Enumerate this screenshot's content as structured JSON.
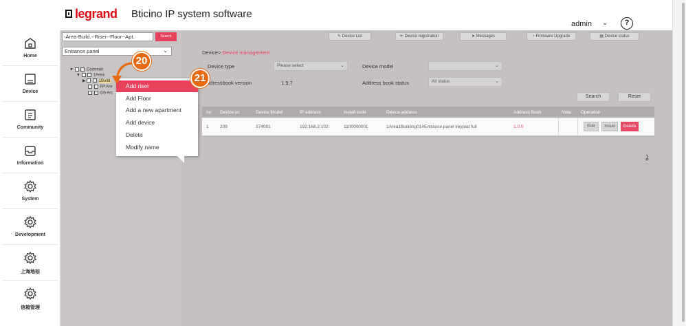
{
  "header": {
    "brand": "legrand",
    "title": "Bticino IP system software",
    "user": "admin",
    "help_glyph": "?"
  },
  "nav": {
    "items": [
      {
        "label": "Home",
        "icon": "home-icon"
      },
      {
        "label": "Device",
        "icon": "device-icon"
      },
      {
        "label": "Community",
        "icon": "community-icon"
      },
      {
        "label": "Information",
        "icon": "information-icon"
      },
      {
        "label": "System",
        "icon": "gear-icon"
      },
      {
        "label": "Development",
        "icon": "gear-icon"
      },
      {
        "label": "上海地标",
        "icon": "gear-icon"
      },
      {
        "label": "信箱管理",
        "icon": "gear-icon"
      }
    ]
  },
  "tree_panel": {
    "path_value": "-Area-Build.--Riser--Floor--Apt.",
    "search_label": "Search",
    "entrance_value": "Entrance panel",
    "tree": {
      "root": "Commun",
      "area": "1Area",
      "building": "1Build.",
      "fp": "FP Are",
      "gs": "GS Arc"
    }
  },
  "context_menu": {
    "items": [
      "Add riser",
      "Add Floor",
      "Add a new apartment",
      "Add device",
      "Delete",
      "Modify name"
    ],
    "active_index": 0
  },
  "callouts": {
    "first": "20",
    "second": "21"
  },
  "toolbar": {
    "buttons": [
      "Device List",
      "Device registration",
      "Messages",
      "Firmware Upgrade",
      "Device status"
    ]
  },
  "breadcrumb": {
    "root": "Device",
    "sep": ">",
    "current": "Device management"
  },
  "filters": {
    "device_type_label": "Device type",
    "device_type_value": "Please select",
    "device_model_label": "Device model",
    "device_model_value": "",
    "addressbook_version_label": "Addressbook version",
    "addressbook_version_value": "1.9.7",
    "address_book_status_label": "Address book status",
    "address_book_status_value": "All status",
    "search_label": "Search",
    "reset_label": "Reset"
  },
  "table": {
    "columns": [
      "no",
      "Device uc",
      "Device Model",
      "IP address",
      "Install code",
      "Device address",
      "Address Book",
      "Note",
      "Operation"
    ],
    "rows": [
      {
        "no": "1",
        "device_uc": "209",
        "device_model": "374001",
        "ip_address": "192.168.2.102",
        "install_code": "1100000001",
        "device_address": "1Area1Building01#Entrance panel keypad full",
        "address_book": "1.0.0",
        "note": "",
        "ops": [
          "Edit",
          "Issue",
          "Delete"
        ]
      }
    ]
  },
  "pagination": {
    "current": "1"
  },
  "colors": {
    "accent": "#e8415c",
    "callout": "#e86a10",
    "panel_gray": "#c5c1c1"
  }
}
